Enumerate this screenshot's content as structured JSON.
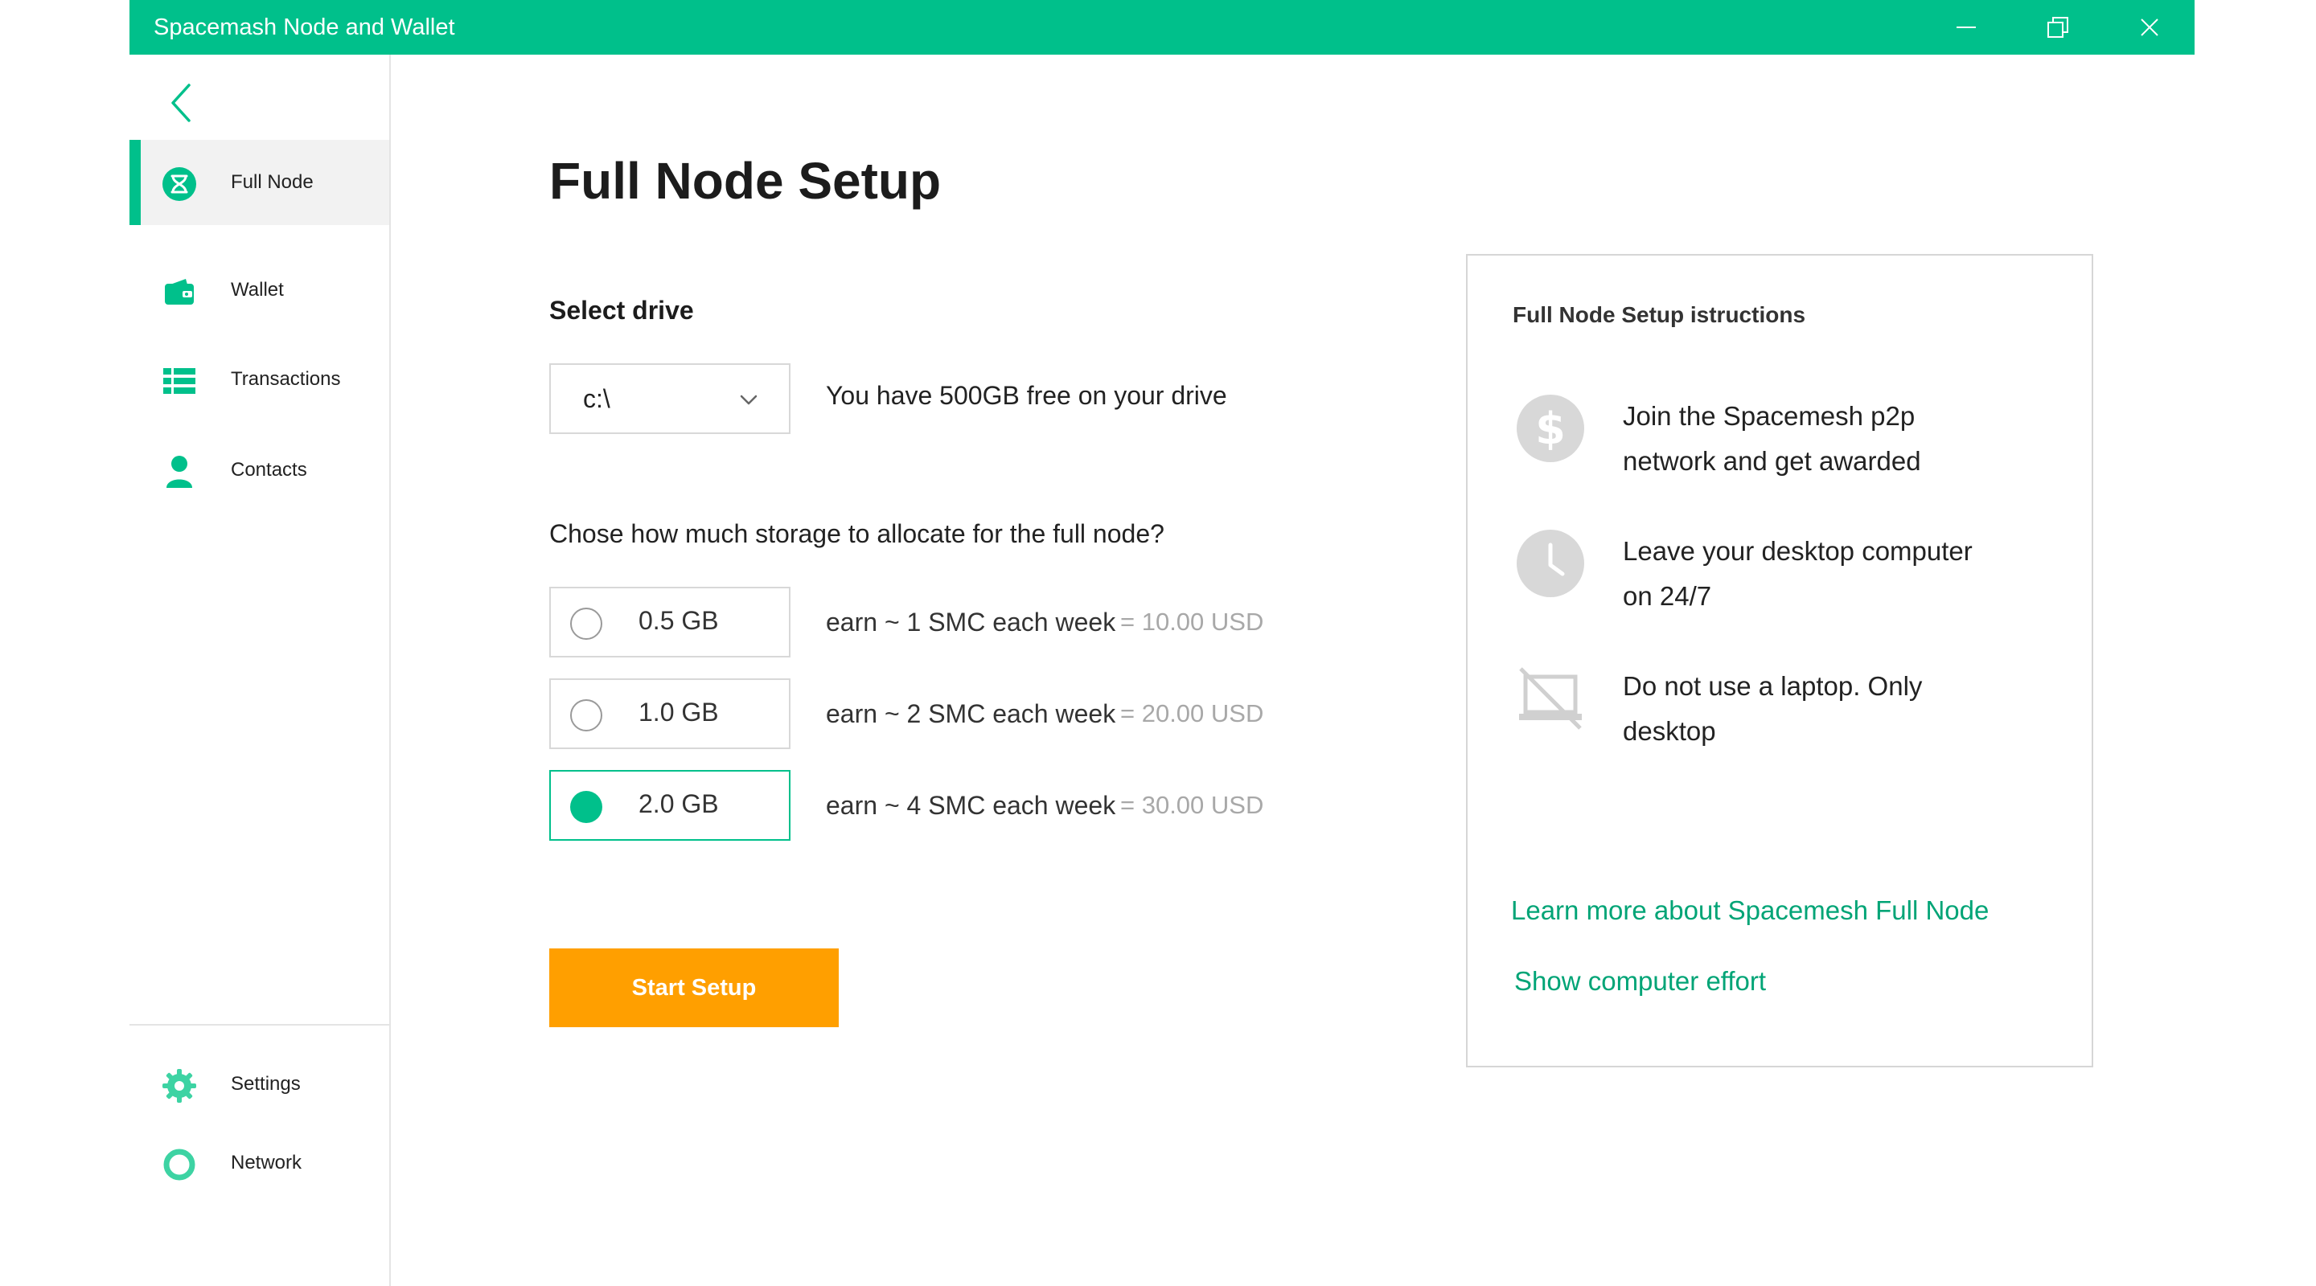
{
  "window": {
    "title": "Spacemash Node and Wallet",
    "accent_color": "#00c08b",
    "controls": [
      "minimize-icon",
      "restore-icon",
      "close-icon"
    ]
  },
  "sidebar": {
    "back_icon": "chevron-left-icon",
    "items": [
      {
        "label": "Full Node",
        "icon": "spacemesh-logo-icon",
        "active": true
      },
      {
        "label": "Wallet",
        "icon": "wallet-icon",
        "active": false
      },
      {
        "label": "Transactions",
        "icon": "list-icon",
        "active": false
      },
      {
        "label": "Contacts",
        "icon": "person-icon",
        "active": false
      }
    ],
    "bottom_items": [
      {
        "label": "Settings",
        "icon": "gear-icon"
      },
      {
        "label": "Network",
        "icon": "ring-icon"
      }
    ]
  },
  "main": {
    "title": "Full Node Setup",
    "select_drive_label": "Select drive",
    "drive": {
      "value": "c:\\",
      "info": "You have 500GB free on your drive"
    },
    "storage_question": "Chose how much storage to allocate for the full node?",
    "options": [
      {
        "size": "0.5 GB",
        "earn": "earn ~ 1 SMC each week",
        "usd": "= 10.00 USD",
        "selected": false
      },
      {
        "size": "1.0 GB",
        "earn": "earn ~ 2 SMC each week",
        "usd": "= 20.00 USD",
        "selected": false
      },
      {
        "size": "2.0 GB",
        "earn": "earn ~ 4 SMC each week",
        "usd": "= 30.00 USD",
        "selected": true
      }
    ],
    "start_button": "Start Setup",
    "start_button_color": "#ff9f00"
  },
  "panel": {
    "title": "Full Node Setup istructions",
    "instructions": [
      {
        "icon": "dollar-coin-icon",
        "line1": "Join the Spacemesh p2p",
        "line2": "network and get awarded"
      },
      {
        "icon": "clock-icon",
        "line1": "Leave your desktop computer",
        "line2": "on 24/7"
      },
      {
        "icon": "no-laptop-icon",
        "line1": "Do not use a laptop. Only",
        "line2": "desktop"
      }
    ],
    "learn_more_link": "Learn more about Spacemesh Full Node",
    "effort_link": "Show computer effort",
    "link_color": "#00a476"
  }
}
